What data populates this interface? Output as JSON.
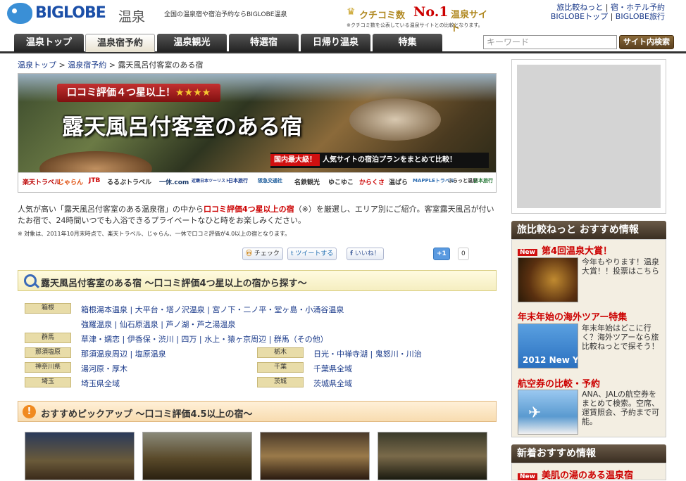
{
  "header": {
    "logo_text": "BIGLOBE",
    "logo_sub": "温泉",
    "tagline": "全国の温泉宿や宿泊予約ならBIGLOBE温泉",
    "kuchikomi": {
      "label": "クチコミ数",
      "rank": "No.1",
      "suffix": "温泉サイト",
      "note": "※クチコミ数を公表している温泉サイトとの比較となります。"
    },
    "links": [
      "旅比較ねっと",
      "宿・ホテル予約",
      "BIGLOBEトップ",
      "BIGLOBE旅行"
    ]
  },
  "nav": {
    "tabs": [
      "温泉トップ",
      "温泉宿予約",
      "温泉観光",
      "特選宿",
      "日帰り温泉",
      "特集"
    ],
    "active_index": 1,
    "search_placeholder": "キーワード",
    "search_button": "サイト内検索"
  },
  "breadcrumb": [
    "温泉トップ",
    "温泉宿予約",
    "露天風呂付客室のある宿"
  ],
  "banner": {
    "rating_text": "口コミ評価４つ星以上！",
    "stars": "★★★★",
    "title": "露天風呂付客室のある宿",
    "compare_highlight": "国内最大級！",
    "compare_text": "人気サイトの宿泊プランをまとめて比較！",
    "partners": [
      "楽天トラベル",
      "じゃらん",
      "JTB",
      "るるぶトラベル",
      "一休.com",
      "近畿日本ツーリスト",
      "日本旅行",
      "阪急交通社",
      "名鉄観光",
      "ゆこゆこ",
      "からくさ",
      "温ぱら",
      "MAPPLEトラベル",
      "ふらっと温泉",
      "日本旅行"
    ]
  },
  "intro": {
    "text_before": "人気が高い「露天風呂付客室のある温泉宿」の中から",
    "text_red": "口コミ評価4つ星以上の宿",
    "text_after": "（※）を厳選し、エリア別にご紹介。客室露天風呂が付いたお宿で、24時間いつでも入浴できるプライベートなひと時をお楽しみください。",
    "note": "※ 対象は、2011年10月末時点で、楽天トラベル、じゃらん、一休で口コミ評価が4.0以上の宿となります。"
  },
  "social": {
    "check": "チェック",
    "tweet": "ツイートする",
    "like": "いいね！",
    "plusone": "+1",
    "count": "0"
  },
  "area_section": {
    "title": "露天風呂付客室のある宿 ～口コミ評価4つ星以上の宿から探す～",
    "rows": [
      {
        "region": "箱根",
        "areas": [
          "箱根湯本温泉",
          "大平台・塔ノ沢温泉",
          "宮ノ下・二ノ平・堂ヶ島・小涌谷温泉"
        ]
      },
      {
        "region": "",
        "areas": [
          "強羅温泉",
          "仙石原温泉",
          "芦ノ湖・芦之湯温泉"
        ]
      },
      {
        "region": "群馬",
        "areas": [
          "草津・嬬恋",
          "伊香保・渋川",
          "四万",
          "水上・猿ヶ京周辺",
          "群馬（その他）"
        ]
      },
      {
        "region": "那須塩原",
        "areas": [
          "那須温泉周辺",
          "塩原温泉"
        ],
        "region2": "栃木",
        "areas2": [
          "日光・中禅寺湖",
          "鬼怒川・川治"
        ]
      },
      {
        "region": "神奈川県",
        "areas": [
          "湯河原・厚木"
        ],
        "region2": "千葉",
        "areas2": [
          "千葉県全域"
        ]
      },
      {
        "region": "埼玉",
        "areas": [
          "埼玉県全域"
        ],
        "region2": "茨城",
        "areas2": [
          "茨城県全域"
        ]
      }
    ]
  },
  "pickup_section": {
    "icon": "!",
    "title": "おすすめピックアップ ～口コミ評価4.5以上の宿～"
  },
  "sidebar": {
    "recommend_head": "旅比較ねっと おすすめ情報",
    "items": [
      {
        "badge": "New",
        "title": "第4回温泉大賞！",
        "text": "今年もやります！温泉大賞！！投票はこちら"
      },
      {
        "badge": "",
        "title": "年末年始の海外ツアー特集",
        "text": "年末年始はどこに行く？海外ツアーなら旅比較ねっとで探そう！",
        "img_text": "2012 New Year"
      },
      {
        "badge": "",
        "title": "航空券の比較・予約",
        "text": "ANA、JALの航空券をまとめて検索。空席、運賃照会、予約まで可能。"
      }
    ],
    "new_head": "新着おすすめ情報",
    "new_item": {
      "badge": "New",
      "title": "美肌の湯のある温泉宿"
    }
  }
}
